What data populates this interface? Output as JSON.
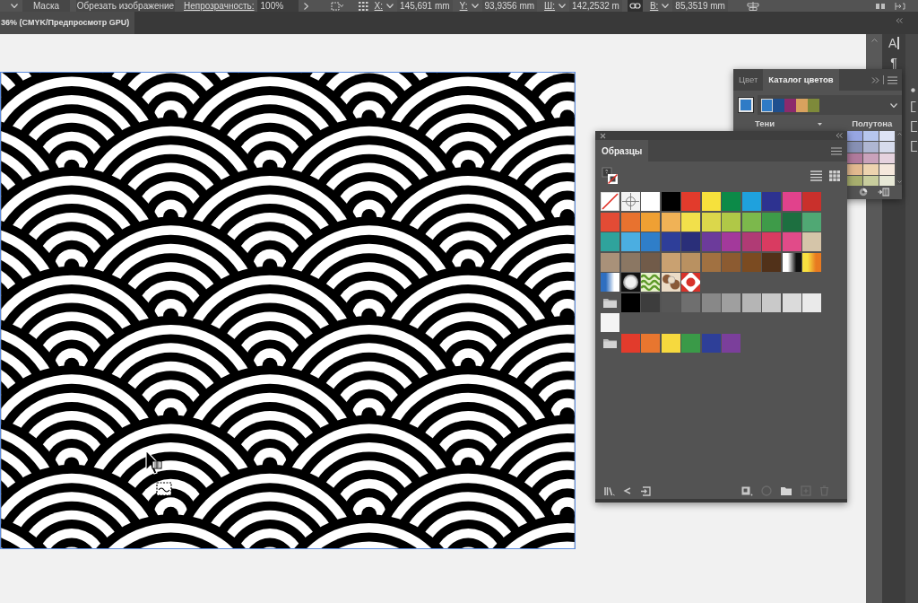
{
  "control_bar": {
    "buttons": [
      {
        "label": "Маска"
      },
      {
        "label": "Обрезать изображение"
      }
    ],
    "opacity": {
      "label": "Непрозрачность:",
      "value": "100%"
    },
    "transform_fields": [
      {
        "label": "X:",
        "value": "145,691 mm"
      },
      {
        "label": "Y:",
        "value": "93,9356 mm"
      },
      {
        "label": "Ш:",
        "value": "142,2532 m"
      },
      {
        "label": "В:",
        "value": "85,3519 mm"
      }
    ]
  },
  "document_tab": {
    "title": "36% (CMYK/Предпросмотр GPU)",
    "selected": true
  },
  "dock": {
    "buttons": [
      {
        "glyph": "A"
      },
      {
        "glyph": "¶"
      }
    ]
  },
  "color_guide_panel": {
    "tabs": [
      {
        "label": "Цвет",
        "selected": false
      },
      {
        "label": "Каталог цветов",
        "selected": true
      }
    ],
    "base_color": {
      "color": "#2f7bc6"
    },
    "harmony_colors": [
      {
        "color": "#2f7bc6",
        "selected": true
      },
      {
        "color": "#1f4f8e",
        "selected": false
      },
      {
        "color": "#8c2a6c",
        "selected": false
      },
      {
        "color": "#d9a25e",
        "selected": false
      },
      {
        "color": "#7e8a3a",
        "selected": false
      }
    ],
    "shades_label": "Тени",
    "tints_label": "Полутона",
    "variations": [
      [
        {
          "color": "#97a6e2"
        },
        {
          "color": "#b6c6ee"
        },
        {
          "color": "#dde3f5"
        }
      ],
      [
        {
          "color": "#8790b4"
        },
        {
          "color": "#aeb6d2"
        },
        {
          "color": "#d6dbec"
        }
      ],
      [
        {
          "color": "#b07a9c"
        },
        {
          "color": "#c9a2bb"
        },
        {
          "color": "#e5d2de"
        }
      ],
      [
        {
          "color": "#e2b98f"
        },
        {
          "color": "#edd3af"
        },
        {
          "color": "#f5e8dc"
        }
      ],
      [
        {
          "color": "#a7ae6e"
        },
        {
          "color": "#c8cd9d"
        },
        {
          "color": "#e7e8d6"
        }
      ]
    ]
  },
  "swatches_panel": {
    "title": "Образцы",
    "groups": [
      {
        "kind": "default",
        "swatches": [
          {
            "kind": "none"
          },
          {
            "kind": "registration"
          },
          {
            "kind": "solid",
            "color": "#ffffff"
          },
          {
            "kind": "solid",
            "color": "#000000"
          },
          {
            "kind": "solid",
            "color": "#e23b2c"
          },
          {
            "kind": "solid",
            "color": "#f6e13c"
          },
          {
            "kind": "solid",
            "color": "#0c8a48"
          },
          {
            "kind": "solid",
            "color": "#1fa1dd"
          },
          {
            "kind": "solid",
            "color": "#2d3290"
          },
          {
            "kind": "solid",
            "color": "#e1428c"
          },
          {
            "kind": "solid",
            "color": "#c9302c"
          },
          {
            "kind": "solid",
            "color": "#e34b35"
          },
          {
            "kind": "solid",
            "color": "#e8722f"
          },
          {
            "kind": "solid",
            "color": "#efa033"
          },
          {
            "kind": "solid",
            "color": "#f0b256"
          },
          {
            "kind": "solid",
            "color": "#f2e04b"
          },
          {
            "kind": "solid",
            "color": "#dbd74b"
          },
          {
            "kind": "solid",
            "color": "#b0c847"
          },
          {
            "kind": "solid",
            "color": "#7cb84c"
          },
          {
            "kind": "solid",
            "color": "#3e9b49"
          },
          {
            "kind": "solid",
            "color": "#1d6f40"
          },
          {
            "kind": "solid",
            "color": "#50a874"
          },
          {
            "kind": "solid",
            "color": "#2fa39c"
          },
          {
            "kind": "solid",
            "color": "#4baee1"
          },
          {
            "kind": "solid",
            "color": "#2f7ec9"
          },
          {
            "kind": "solid",
            "color": "#2e3e99"
          },
          {
            "kind": "solid",
            "color": "#2a2f79"
          },
          {
            "kind": "solid",
            "color": "#6c3b9b"
          },
          {
            "kind": "solid",
            "color": "#a3399b"
          },
          {
            "kind": "solid",
            "color": "#b03b75"
          },
          {
            "kind": "solid",
            "color": "#d93b61"
          },
          {
            "kind": "solid",
            "color": "#e14b89"
          },
          {
            "kind": "solid",
            "color": "#d5c5a9"
          },
          {
            "kind": "solid",
            "color": "#a99179"
          },
          {
            "kind": "solid",
            "color": "#8b7763"
          },
          {
            "kind": "solid",
            "color": "#715b49"
          },
          {
            "kind": "solid",
            "color": "#c9a171"
          },
          {
            "kind": "solid",
            "color": "#b99161"
          },
          {
            "kind": "solid",
            "color": "#a17141"
          },
          {
            "kind": "solid",
            "color": "#8c5b31"
          },
          {
            "kind": "solid",
            "color": "#7b4b21"
          },
          {
            "kind": "solid",
            "color": "#513119"
          },
          {
            "kind": "gradient",
            "stops": [
              {
                "color": "#ffffff"
              },
              {
                "color": "#111111"
              }
            ]
          },
          {
            "kind": "gradient",
            "stops": [
              {
                "color": "#f8e040"
              },
              {
                "color": "#e87a20"
              }
            ]
          },
          {
            "kind": "gradient",
            "stops": [
              {
                "color": "#2f6fc0"
              },
              {
                "color": "#ffffff"
              }
            ]
          },
          {
            "kind": "radial",
            "stops": [
              {
                "color": "#f0f0f0"
              },
              {
                "color": "#111111"
              }
            ]
          },
          {
            "kind": "pattern",
            "stops": [
              {
                "color": "#e6f0c8"
              },
              {
                "color": "#5e9a2a"
              }
            ]
          },
          {
            "kind": "pattern",
            "stops": [
              {
                "color": "#ecdcc6"
              },
              {
                "color": "#8a5a38"
              }
            ]
          },
          {
            "kind": "pattern",
            "stops": [
              {
                "color": "#ffffff"
              },
              {
                "color": "#d8322a"
              }
            ]
          }
        ]
      },
      {
        "kind": "folder",
        "swatches": [
          {
            "kind": "solid",
            "color": "#000000"
          },
          {
            "kind": "solid",
            "color": "#3d3d3d"
          },
          {
            "kind": "solid",
            "color": "#575757"
          },
          {
            "kind": "solid",
            "color": "#6f6f6f"
          },
          {
            "kind": "solid",
            "color": "#888888"
          },
          {
            "kind": "solid",
            "color": "#9f9f9f"
          },
          {
            "kind": "solid",
            "color": "#b5b5b5"
          },
          {
            "kind": "solid",
            "color": "#c9c9c9"
          },
          {
            "kind": "solid",
            "color": "#dbdbdb"
          },
          {
            "kind": "solid",
            "color": "#eaeaea"
          },
          {
            "kind": "solid",
            "color": "#f4f4f4"
          }
        ]
      },
      {
        "kind": "folder",
        "swatches": [
          {
            "kind": "solid",
            "color": "#e23b2c"
          },
          {
            "kind": "solid",
            "color": "#e8762f"
          },
          {
            "kind": "solid",
            "color": "#f6d93e"
          },
          {
            "kind": "solid",
            "color": "#3a9a48"
          },
          {
            "kind": "solid",
            "color": "#2e3f98"
          },
          {
            "kind": "solid",
            "color": "#7b3f9b"
          }
        ]
      }
    ]
  }
}
